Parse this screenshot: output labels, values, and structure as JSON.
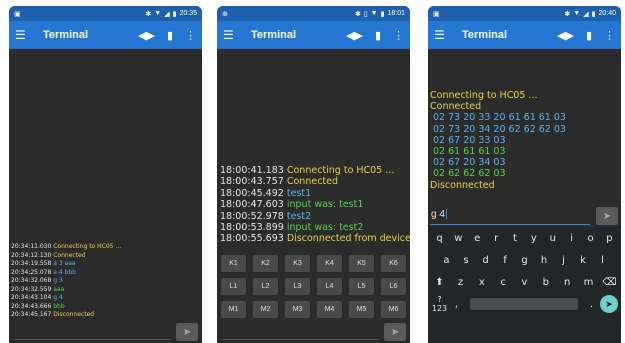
{
  "app": {
    "title": "Terminal",
    "icons": {
      "menu": "menu-icon",
      "connect": "connect-icon",
      "clear": "trash-icon",
      "more": "more-vert-icon"
    },
    "colors": {
      "statusbar": "#1e5fae",
      "toolbar": "#2677d3",
      "background": "#2b2b2b",
      "yellow": "#e8d440",
      "blue": "#5ab4f0",
      "green": "#56d64a"
    }
  },
  "screen1": {
    "status_time": "20:35",
    "lines": [
      {
        "ts": "20:34:11.030",
        "text": "Connecting to HC05 ...",
        "color": "c-yellow"
      },
      {
        "ts": "20:34:12.130",
        "text": "Connected",
        "color": "c-yellow"
      },
      {
        "ts": "20:34:19.558",
        "text": "a 3 aaa",
        "color": "c-blue"
      },
      {
        "ts": "20:34:25.078",
        "text": "a 4 bbb",
        "color": "c-blue"
      },
      {
        "ts": "20:34:32.068",
        "text": "g 3",
        "color": "c-blue"
      },
      {
        "ts": "20:34:32.559",
        "text": "aaa",
        "color": "c-green"
      },
      {
        "ts": "20:34:43.104",
        "text": "g 4",
        "color": "c-blue"
      },
      {
        "ts": "20:34:43.666",
        "text": "bbb",
        "color": "c-green"
      },
      {
        "ts": "20:34:45.167",
        "text": "Disconnected",
        "color": "c-yellow"
      }
    ],
    "send_icon": "send-icon"
  },
  "screen2": {
    "status_time": "18:01",
    "lines": [
      {
        "ts": "18:00:41.183",
        "text": "Connecting to HC05 ...",
        "color": "c-yellow"
      },
      {
        "ts": "18:00:43.757",
        "text": "Connected",
        "color": "c-yellow"
      },
      {
        "ts": "18:00:45.492",
        "text": "test1",
        "color": "c-blue"
      },
      {
        "ts": "18:00:47.603",
        "text": "input was: test1",
        "color": "c-green"
      },
      {
        "ts": "18:00:52.978",
        "text": "test2",
        "color": "c-blue"
      },
      {
        "ts": "18:00:53.899",
        "text": "input was: test2",
        "color": "c-green"
      },
      {
        "ts": "18:00:55.693",
        "text": "Disconnected from device",
        "color": "c-yellow"
      }
    ],
    "macro_keys": [
      "K1",
      "K2",
      "K3",
      "K4",
      "K5",
      "K6",
      "L1",
      "L2",
      "L3",
      "L4",
      "L5",
      "L6",
      "M1",
      "M2",
      "M3",
      "M4",
      "M5",
      "M6"
    ]
  },
  "screen3": {
    "status_time": "20:40",
    "lines": [
      {
        "text": "Connecting to HC05 ...",
        "color": "c-yellow",
        "hex": false
      },
      {
        "text": "Connected",
        "color": "c-yellow",
        "hex": false
      },
      {
        "text": "02 73 20 33 20 61 61 61 03",
        "color": "c-blue",
        "hex": true
      },
      {
        "text": "02 73 20 34 20 62 62 62 03",
        "color": "c-blue",
        "hex": true
      },
      {
        "text": "02 67 20 33 03",
        "color": "c-blue",
        "hex": true
      },
      {
        "text": "02 61 61 61 03",
        "color": "c-green",
        "hex": true
      },
      {
        "text": "02 67 20 34 03",
        "color": "c-blue",
        "hex": true
      },
      {
        "text": "02 62 62 62 03",
        "color": "c-green",
        "hex": true
      },
      {
        "text": "Disconnected",
        "color": "c-yellow",
        "hex": false
      }
    ],
    "input_value": "g 4",
    "keyboard": {
      "row1": [
        "q",
        "w",
        "e",
        "r",
        "t",
        "y",
        "u",
        "i",
        "o",
        "p"
      ],
      "row2": [
        "a",
        "s",
        "d",
        "f",
        "g",
        "h",
        "j",
        "k",
        "l"
      ],
      "row3": [
        "z",
        "x",
        "c",
        "v",
        "b",
        "n",
        "m"
      ],
      "symbols_key": "?123",
      "comma_key": ",",
      "period_key": "."
    }
  }
}
